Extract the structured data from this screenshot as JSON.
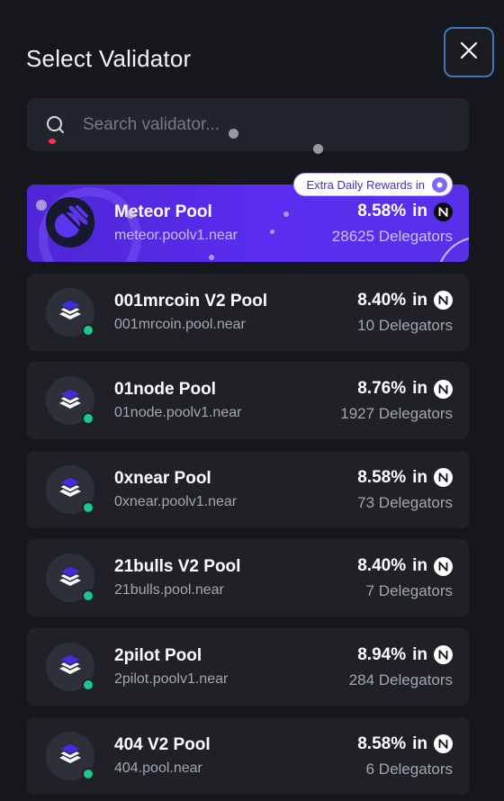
{
  "header": {
    "title": "Select Validator"
  },
  "search": {
    "placeholder": "Search validator..."
  },
  "featured_badge": "Extra Daily Rewards in",
  "apy_suffix": "in",
  "colors": {
    "accent": "#5a2df0",
    "online": "#1ec88a",
    "close_border": "#3f77b8"
  },
  "validators": [
    {
      "name": "Meteor Pool",
      "account": "meteor.poolv1.near",
      "apy": "8.58%",
      "delegators": "28625 Delegators",
      "featured": true
    },
    {
      "name": "001mrcoin V2 Pool",
      "account": "001mrcoin.pool.near",
      "apy": "8.40%",
      "delegators": "10 Delegators"
    },
    {
      "name": "01node Pool",
      "account": "01node.poolv1.near",
      "apy": "8.76%",
      "delegators": "1927 Delegators"
    },
    {
      "name": "0xnear Pool",
      "account": "0xnear.poolv1.near",
      "apy": "8.58%",
      "delegators": "73 Delegators"
    },
    {
      "name": "21bulls V2 Pool",
      "account": "21bulls.pool.near",
      "apy": "8.40%",
      "delegators": "7 Delegators"
    },
    {
      "name": "2pilot Pool",
      "account": "2pilot.poolv1.near",
      "apy": "8.94%",
      "delegators": "284 Delegators"
    },
    {
      "name": "404 V2 Pool",
      "account": "404.pool.near",
      "apy": "8.58%",
      "delegators": "6 Delegators"
    }
  ]
}
